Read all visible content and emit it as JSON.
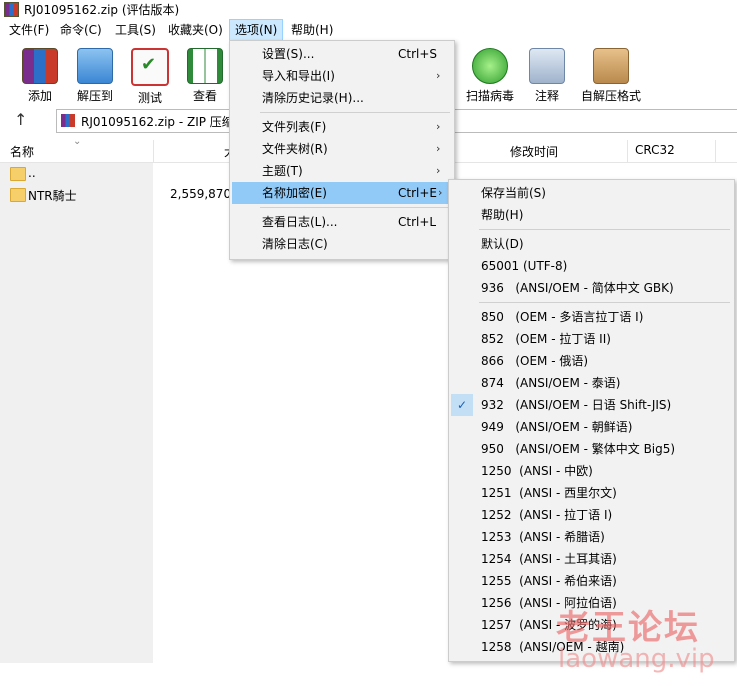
{
  "window": {
    "title": "RJ01095162.zip (评估版本)"
  },
  "menubar": [
    {
      "label": "文件(F)"
    },
    {
      "label": "命令(C)"
    },
    {
      "label": "工具(S)"
    },
    {
      "label": "收藏夹(O)"
    },
    {
      "label": "选项(N)"
    },
    {
      "label": "帮助(H)"
    }
  ],
  "toolbar": [
    {
      "label": "添加",
      "icon": "add-archive-icon"
    },
    {
      "label": "解压到",
      "icon": "extract-to-icon"
    },
    {
      "label": "测试",
      "icon": "test-icon"
    },
    {
      "label": "查看",
      "icon": "view-book-icon"
    },
    {
      "label": "扫描病毒",
      "icon": "virus-scan-icon"
    },
    {
      "label": "注释",
      "icon": "comment-icon"
    },
    {
      "label": "自解压格式",
      "icon": "sfx-icon"
    }
  ],
  "address": {
    "path": "RJ01095162.zip - ZIP 压缩"
  },
  "columns": {
    "name": "名称",
    "size": "大",
    "modified": "修改时间",
    "crc": "CRC32"
  },
  "files": [
    {
      "name": "..",
      "size": ""
    },
    {
      "name": "NTR騎士",
      "size": "2,559,870,4"
    }
  ],
  "options_menu": [
    {
      "label": "设置(S)...",
      "shortcut": "Ctrl+S",
      "submenu": false
    },
    {
      "label": "导入和导出(I)",
      "shortcut": "",
      "submenu": true
    },
    {
      "label": "清除历史记录(H)...",
      "shortcut": "",
      "submenu": false
    },
    {
      "label": "文件列表(F)",
      "shortcut": "",
      "submenu": true
    },
    {
      "label": "文件夹树(R)",
      "shortcut": "",
      "submenu": true
    },
    {
      "label": "主题(T)",
      "shortcut": "",
      "submenu": true
    },
    {
      "label": "名称加密(E)",
      "shortcut": "Ctrl+E",
      "submenu": true
    },
    {
      "label": "查看日志(L)...",
      "shortcut": "Ctrl+L",
      "submenu": false
    },
    {
      "label": "清除日志(C)",
      "shortcut": "",
      "submenu": false
    }
  ],
  "encoding_menu": [
    {
      "label": "保存当前(S)",
      "checked": false
    },
    {
      "label": "帮助(H)",
      "checked": false
    },
    {
      "label": "默认(D)",
      "checked": false
    },
    {
      "label": "65001 (UTF-8)",
      "checked": false
    },
    {
      "label": "936   (ANSI/OEM - 简体中文 GBK)",
      "checked": false
    },
    {
      "label": "850   (OEM - 多语言拉丁语 I)",
      "checked": false
    },
    {
      "label": "852   (OEM - 拉丁语 II)",
      "checked": false
    },
    {
      "label": "866   (OEM - 俄语)",
      "checked": false
    },
    {
      "label": "874   (ANSI/OEM - 泰语)",
      "checked": false
    },
    {
      "label": "932   (ANSI/OEM - 日语 Shift-JIS)",
      "checked": true
    },
    {
      "label": "949   (ANSI/OEM - 朝鲜语)",
      "checked": false
    },
    {
      "label": "950   (ANSI/OEM - 繁体中文 Big5)",
      "checked": false
    },
    {
      "label": "1250  (ANSI - 中欧)",
      "checked": false
    },
    {
      "label": "1251  (ANSI - 西里尔文)",
      "checked": false
    },
    {
      "label": "1252  (ANSI - 拉丁语 I)",
      "checked": false
    },
    {
      "label": "1253  (ANSI - 希腊语)",
      "checked": false
    },
    {
      "label": "1254  (ANSI - 土耳其语)",
      "checked": false
    },
    {
      "label": "1255  (ANSI - 希伯来语)",
      "checked": false
    },
    {
      "label": "1256  (ANSI - 阿拉伯语)",
      "checked": false
    },
    {
      "label": "1257  (ANSI - 波罗的海)",
      "checked": false
    },
    {
      "label": "1258  (ANSI/OEM - 越南)",
      "checked": false
    }
  ],
  "watermark": {
    "line1": "老王论坛",
    "line2": "laowang.vip"
  }
}
